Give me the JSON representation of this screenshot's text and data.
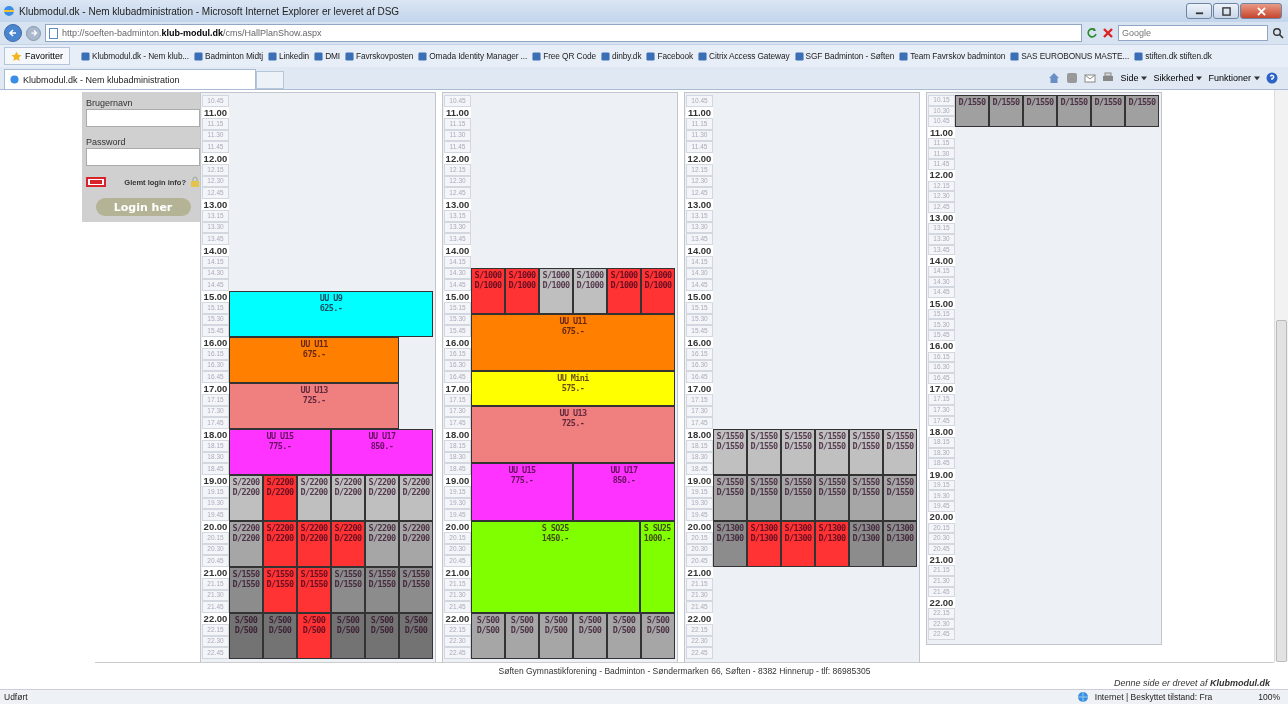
{
  "window": {
    "title": "Klubmodul.dk - Nem klubadministration - Microsoft Internet Explorer er leveret af DSG"
  },
  "address_bar": {
    "url": "http://soeften-badminton.**klub-modul.dk**/cms/HallPlanShow.aspx"
  },
  "search": {
    "placeholder": "Google"
  },
  "favorites": {
    "button": "Favoritter",
    "items": [
      "Klubmodul.dk - Nem klub...",
      "Badminton Midtj",
      "Linkedin",
      "DMI",
      "Favrskovposten",
      "Omada Identity Manager ...",
      "Free QR Code",
      "dinby.dk",
      "Facebook",
      "Citrix Access Gateway",
      "SGF Badminton - Søften",
      "Team Favrskov badminton",
      "SAS EUROBONUS MASTE...",
      "stiften.dk stiften.dk"
    ]
  },
  "tab": {
    "title": "Klubmodul.dk - Nem klubadministration"
  },
  "commands": [
    "Side",
    "Sikkerhed",
    "Funktioner"
  ],
  "login": {
    "username_label": "Brugernavn",
    "password_label": "Password",
    "forgot": "Glemt login info?",
    "button": "Login her"
  },
  "halls": [
    {
      "bands": [
        {
          "slots": [
            {
              "t": "10.45",
              "major": false
            },
            {
              "t": "11.00",
              "major": true
            },
            {
              "t": "11.15",
              "major": false
            },
            {
              "t": "11.30",
              "major": false
            },
            {
              "t": "11.45",
              "major": false
            },
            {
              "t": "12.00",
              "major": true
            },
            {
              "t": "12.15",
              "major": false
            },
            {
              "t": "12.30",
              "major": false
            },
            {
              "t": "12.45",
              "major": false
            },
            {
              "t": "13.00",
              "major": true
            },
            {
              "t": "13.15",
              "major": false
            },
            {
              "t": "13.30",
              "major": false
            },
            {
              "t": "13.45",
              "major": false
            },
            {
              "t": "14.00",
              "major": true
            },
            {
              "t": "14.15",
              "major": false
            },
            {
              "t": "14.30",
              "major": false
            },
            {
              "t": "14.45",
              "major": false
            }
          ]
        },
        {
          "slots": [
            {
              "t": "15.00",
              "major": true
            },
            {
              "t": "15.15",
              "major": false
            },
            {
              "t": "15.30",
              "major": false
            },
            {
              "t": "15.45",
              "major": false
            }
          ],
          "cells": [
            {
              "kind": "booking",
              "color": "#00ffff",
              "lines": [
                "UU U9",
                "625.-"
              ]
            },
            {
              "kind": "span"
            },
            {
              "kind": "span"
            },
            {
              "kind": "span"
            },
            {
              "kind": "span"
            },
            {
              "kind": "span"
            }
          ]
        },
        {
          "slots": [
            {
              "t": "16.00",
              "major": true
            },
            {
              "t": "16.15",
              "major": false
            },
            {
              "t": "16.30",
              "major": false
            },
            {
              "t": "16.45",
              "major": false
            }
          ],
          "cells": [
            {
              "kind": "booking",
              "color": "#ff8000",
              "lines": [
                "UU U11",
                "675.-"
              ]
            },
            {
              "kind": "span"
            },
            {
              "kind": "span"
            },
            {
              "kind": "span"
            },
            {
              "kind": "span"
            },
            {
              "kind": "free"
            }
          ]
        },
        {
          "slots": [
            {
              "t": "17.00",
              "major": true
            },
            {
              "t": "17.15",
              "major": false
            },
            {
              "t": "17.30",
              "major": false
            },
            {
              "t": "17.45",
              "major": false
            }
          ],
          "cells": [
            {
              "kind": "booking",
              "color": "#f08080",
              "lines": [
                "UU U13",
                "725.-"
              ]
            },
            {
              "kind": "span"
            },
            {
              "kind": "span"
            },
            {
              "kind": "span"
            },
            {
              "kind": "span"
            },
            {
              "kind": "free"
            }
          ]
        },
        {
          "slots": [
            {
              "t": "18.00",
              "major": true
            },
            {
              "t": "18.15",
              "major": false
            },
            {
              "t": "18.30",
              "major": false
            },
            {
              "t": "18.45",
              "major": false
            }
          ],
          "cells": [
            {
              "kind": "booking",
              "color": "#ff33ff",
              "lines": [
                "UU U15",
                "775.-"
              ]
            },
            {
              "kind": "span"
            },
            {
              "kind": "span"
            },
            {
              "kind": "booking",
              "color": "#ff33ff",
              "lines": [
                "UU U17",
                "850.-"
              ]
            },
            {
              "kind": "span"
            },
            {
              "kind": "span"
            }
          ]
        },
        {
          "slots": [
            {
              "t": "19.00",
              "major": true
            },
            {
              "t": "19.15",
              "major": false
            },
            {
              "t": "19.30",
              "major": false
            },
            {
              "t": "19.45",
              "major": false
            }
          ],
          "cells": [
            {
              "kind": "booking",
              "color": "#bfbfbf",
              "lines": [
                "S/2200",
                "D/2200"
              ]
            },
            {
              "kind": "booking",
              "color": "#ff3333",
              "lines": [
                "S/2200",
                "D/2200"
              ]
            },
            {
              "kind": "booking",
              "color": "#bfbfbf",
              "lines": [
                "S/2200",
                "D/2200"
              ]
            },
            {
              "kind": "booking",
              "color": "#bfbfbf",
              "lines": [
                "S/2200",
                "D/2200"
              ]
            },
            {
              "kind": "booking",
              "color": "#bfbfbf",
              "lines": [
                "S/2200",
                "D/2200"
              ]
            },
            {
              "kind": "booking",
              "color": "#bfbfbf",
              "lines": [
                "S/2200",
                "D/2200"
              ]
            }
          ]
        },
        {
          "slots": [
            {
              "t": "20.00",
              "major": true
            },
            {
              "t": "20.15",
              "major": false
            },
            {
              "t": "20.30",
              "major": false
            },
            {
              "t": "20.45",
              "major": false
            }
          ],
          "cells": [
            {
              "kind": "booking",
              "color": "#a6a6a6",
              "lines": [
                "S/2200",
                "D/2200"
              ]
            },
            {
              "kind": "booking",
              "color": "#ff3333",
              "lines": [
                "S/2200",
                "D/2200"
              ]
            },
            {
              "kind": "booking",
              "color": "#ff3333",
              "lines": [
                "S/2200",
                "D/2200"
              ]
            },
            {
              "kind": "booking",
              "color": "#ff3333",
              "lines": [
                "S/2200",
                "D/2200"
              ]
            },
            {
              "kind": "booking",
              "color": "#a6a6a6",
              "lines": [
                "S/2200",
                "D/2200"
              ]
            },
            {
              "kind": "booking",
              "color": "#a6a6a6",
              "lines": [
                "S/2200",
                "D/2200"
              ]
            }
          ]
        },
        {
          "slots": [
            {
              "t": "21.00",
              "major": true
            },
            {
              "t": "21.15",
              "major": false
            },
            {
              "t": "21.30",
              "major": false
            },
            {
              "t": "21.45",
              "major": false
            }
          ],
          "cells": [
            {
              "kind": "booking",
              "color": "#8c8c8c",
              "lines": [
                "S/1550",
                "D/1550"
              ]
            },
            {
              "kind": "booking",
              "color": "#ff3333",
              "lines": [
                "S/1550",
                "D/1550"
              ]
            },
            {
              "kind": "booking",
              "color": "#ff3333",
              "lines": [
                "S/1550",
                "D/1550"
              ]
            },
            {
              "kind": "booking",
              "color": "#8c8c8c",
              "lines": [
                "S/1550",
                "D/1550"
              ]
            },
            {
              "kind": "booking",
              "color": "#8c8c8c",
              "lines": [
                "S/1550",
                "D/1550"
              ]
            },
            {
              "kind": "booking",
              "color": "#8c8c8c",
              "lines": [
                "S/1550",
                "D/1550"
              ]
            }
          ]
        },
        {
          "slots": [
            {
              "t": "22.00",
              "major": true
            },
            {
              "t": "22.15",
              "major": false
            },
            {
              "t": "22.30",
              "major": false
            },
            {
              "t": "22.45",
              "major": false
            }
          ],
          "cells": [
            {
              "kind": "booking",
              "color": "#737373",
              "lines": [
                "S/500",
                "D/500"
              ]
            },
            {
              "kind": "booking",
              "color": "#737373",
              "lines": [
                "S/500",
                "D/500"
              ]
            },
            {
              "kind": "booking",
              "color": "#ff3333",
              "lines": [
                "S/500",
                "D/500"
              ]
            },
            {
              "kind": "booking",
              "color": "#737373",
              "lines": [
                "S/500",
                "D/500"
              ]
            },
            {
              "kind": "booking",
              "color": "#737373",
              "lines": [
                "S/500",
                "D/500"
              ]
            },
            {
              "kind": "booking",
              "color": "#737373",
              "lines": [
                "S/500",
                "D/500"
              ]
            }
          ]
        }
      ]
    },
    {
      "bands": [
        {
          "slots": [
            {
              "t": "10.45",
              "major": false
            },
            {
              "t": "11.00",
              "major": true
            },
            {
              "t": "11.15",
              "major": false
            },
            {
              "t": "11.30",
              "major": false
            },
            {
              "t": "11.45",
              "major": false
            },
            {
              "t": "12.00",
              "major": true
            },
            {
              "t": "12.15",
              "major": false
            },
            {
              "t": "12.30",
              "major": false
            },
            {
              "t": "12.45",
              "major": false
            },
            {
              "t": "13.00",
              "major": true
            },
            {
              "t": "13.15",
              "major": false
            },
            {
              "t": "13.30",
              "major": false
            },
            {
              "t": "13.45",
              "major": false
            },
            {
              "t": "14.00",
              "major": true
            },
            {
              "t": "14.15",
              "major": false
            }
          ]
        },
        {
          "slots": [
            {
              "t": "14.30",
              "major": false
            },
            {
              "t": "14.45",
              "major": false
            },
            {
              "t": "15.00",
              "major": true
            },
            {
              "t": "15.15",
              "major": false
            }
          ],
          "cells": [
            {
              "kind": "booking",
              "color": "#ff3333",
              "lines": [
                "S/1000",
                "D/1000"
              ]
            },
            {
              "kind": "booking",
              "color": "#ff3333",
              "lines": [
                "S/1000",
                "D/1000"
              ]
            },
            {
              "kind": "booking",
              "color": "#bfbfbf",
              "lines": [
                "S/1000",
                "D/1000"
              ]
            },
            {
              "kind": "booking",
              "color": "#bfbfbf",
              "lines": [
                "S/1000",
                "D/1000"
              ]
            },
            {
              "kind": "booking",
              "color": "#ff3333",
              "lines": [
                "S/1000",
                "D/1000"
              ]
            },
            {
              "kind": "booking",
              "color": "#ff3333",
              "lines": [
                "S/1000",
                "D/1000"
              ]
            }
          ]
        },
        {
          "slots": [
            {
              "t": "15.30",
              "major": false
            },
            {
              "t": "15.45",
              "major": false
            },
            {
              "t": "16.00",
              "major": true
            },
            {
              "t": "16.15",
              "major": false
            },
            {
              "t": "16.30",
              "major": false
            }
          ],
          "cells": [
            {
              "kind": "booking",
              "color": "#ff8000",
              "lines": [
                "UU U11",
                "675.-"
              ]
            },
            {
              "kind": "span"
            },
            {
              "kind": "span"
            },
            {
              "kind": "span"
            },
            {
              "kind": "span"
            },
            {
              "kind": "span"
            }
          ]
        },
        {
          "slots": [
            {
              "t": "16.45",
              "major": false
            },
            {
              "t": "17.00",
              "major": true
            },
            {
              "t": "17.15",
              "major": false
            }
          ],
          "cells": [
            {
              "kind": "booking",
              "color": "#ffff00",
              "lines": [
                "UU Mini",
                "575.-"
              ]
            },
            {
              "kind": "span"
            },
            {
              "kind": "span"
            },
            {
              "kind": "span"
            },
            {
              "kind": "span"
            },
            {
              "kind": "span"
            }
          ]
        },
        {
          "slots": [
            {
              "t": "17.30",
              "major": false
            },
            {
              "t": "17.45",
              "major": false
            },
            {
              "t": "18.00",
              "major": true
            },
            {
              "t": "18.15",
              "major": false
            },
            {
              "t": "18.30",
              "major": false
            }
          ],
          "cells": [
            {
              "kind": "booking",
              "color": "#f08080",
              "lines": [
                "UU U13",
                "725.-"
              ]
            },
            {
              "kind": "span"
            },
            {
              "kind": "span"
            },
            {
              "kind": "span"
            },
            {
              "kind": "span"
            },
            {
              "kind": "span"
            }
          ]
        },
        {
          "slots": [
            {
              "t": "18.45",
              "major": false
            },
            {
              "t": "19.00",
              "major": true
            },
            {
              "t": "19.15",
              "major": false
            },
            {
              "t": "19.30",
              "major": false
            },
            {
              "t": "19.45",
              "major": false
            }
          ],
          "cells": [
            {
              "kind": "booking",
              "color": "#ff33ff",
              "lines": [
                "UU U15",
                "775.-"
              ]
            },
            {
              "kind": "span"
            },
            {
              "kind": "span"
            },
            {
              "kind": "booking",
              "color": "#ff33ff",
              "lines": [
                "UU U17",
                "850.-"
              ]
            },
            {
              "kind": "span"
            },
            {
              "kind": "span"
            }
          ]
        },
        {
          "slots": [
            {
              "t": "20.00",
              "major": true
            },
            {
              "t": "20.15",
              "major": false
            },
            {
              "t": "20.30",
              "major": false
            },
            {
              "t": "20.45",
              "major": false
            },
            {
              "t": "21.00",
              "major": true
            },
            {
              "t": "21.15",
              "major": false
            },
            {
              "t": "21.30",
              "major": false
            },
            {
              "t": "21.45",
              "major": false
            }
          ],
          "cells": [
            {
              "kind": "booking",
              "color": "#80ff00",
              "lines": [
                "S SO25",
                "1450.-"
              ]
            },
            {
              "kind": "span"
            },
            {
              "kind": "span"
            },
            {
              "kind": "span"
            },
            {
              "kind": "span"
            },
            {
              "kind": "booking",
              "color": "#80ff00",
              "lines": [
                "S SU25",
                "1000.-"
              ]
            }
          ]
        },
        {
          "slots": [
            {
              "t": "22.00",
              "major": true
            },
            {
              "t": "22.15",
              "major": false
            },
            {
              "t": "22.30",
              "major": false
            },
            {
              "t": "22.45",
              "major": false
            }
          ],
          "cells": [
            {
              "kind": "booking",
              "color": "#a6a6a6",
              "lines": [
                "S/500",
                "D/500"
              ]
            },
            {
              "kind": "booking",
              "color": "#a6a6a6",
              "lines": [
                "S/500",
                "D/500"
              ]
            },
            {
              "kind": "booking",
              "color": "#a6a6a6",
              "lines": [
                "S/500",
                "D/500"
              ]
            },
            {
              "kind": "booking",
              "color": "#a6a6a6",
              "lines": [
                "S/500",
                "D/500"
              ]
            },
            {
              "kind": "booking",
              "color": "#a6a6a6",
              "lines": [
                "S/500",
                "D/500"
              ]
            },
            {
              "kind": "booking",
              "color": "#a6a6a6",
              "lines": [
                "S/500",
                "D/500"
              ]
            }
          ]
        }
      ]
    },
    {
      "bands": [
        {
          "slots": [
            {
              "t": "10.45",
              "major": false
            },
            {
              "t": "11.00",
              "major": true
            },
            {
              "t": "11.15",
              "major": false
            },
            {
              "t": "11.30",
              "major": false
            },
            {
              "t": "11.45",
              "major": false
            },
            {
              "t": "12.00",
              "major": true
            },
            {
              "t": "12.15",
              "major": false
            },
            {
              "t": "12.30",
              "major": false
            },
            {
              "t": "12.45",
              "major": false
            },
            {
              "t": "13.00",
              "major": true
            },
            {
              "t": "13.15",
              "major": false
            },
            {
              "t": "13.30",
              "major": false
            },
            {
              "t": "13.45",
              "major": false
            },
            {
              "t": "14.00",
              "major": true
            },
            {
              "t": "14.15",
              "major": false
            },
            {
              "t": "14.30",
              "major": false
            },
            {
              "t": "14.45",
              "major": false
            },
            {
              "t": "15.00",
              "major": true
            },
            {
              "t": "15.15",
              "major": false
            },
            {
              "t": "15.30",
              "major": false
            },
            {
              "t": "15.45",
              "major": false
            },
            {
              "t": "16.00",
              "major": true
            },
            {
              "t": "16.15",
              "major": false
            },
            {
              "t": "16.30",
              "major": false
            },
            {
              "t": "16.45",
              "major": false
            },
            {
              "t": "17.00",
              "major": true
            },
            {
              "t": "17.15",
              "major": false
            },
            {
              "t": "17.30",
              "major": false
            },
            {
              "t": "17.45",
              "major": false
            }
          ]
        },
        {
          "slots": [
            {
              "t": "18.00",
              "major": true
            },
            {
              "t": "18.15",
              "major": false
            },
            {
              "t": "18.30",
              "major": false
            },
            {
              "t": "18.45",
              "major": false
            }
          ],
          "cells": [
            {
              "kind": "booking",
              "color": "#c0c0c0",
              "lines": [
                "S/1550",
                "D/1550"
              ]
            },
            {
              "kind": "booking",
              "color": "#c0c0c0",
              "lines": [
                "S/1550",
                "D/1550"
              ]
            },
            {
              "kind": "booking",
              "color": "#c0c0c0",
              "lines": [
                "S/1550",
                "D/1550"
              ]
            },
            {
              "kind": "booking",
              "color": "#c0c0c0",
              "lines": [
                "S/1550",
                "D/1550"
              ]
            },
            {
              "kind": "booking",
              "color": "#c0c0c0",
              "lines": [
                "S/1550",
                "D/1550"
              ]
            },
            {
              "kind": "booking",
              "color": "#c0c0c0",
              "lines": [
                "S/1550",
                "D/1550"
              ]
            }
          ]
        },
        {
          "slots": [
            {
              "t": "19.00",
              "major": true
            },
            {
              "t": "19.15",
              "major": false
            },
            {
              "t": "19.30",
              "major": false
            },
            {
              "t": "19.45",
              "major": false
            }
          ],
          "cells": [
            {
              "kind": "booking",
              "color": "#a6a6a6",
              "lines": [
                "S/1550",
                "D/1550"
              ]
            },
            {
              "kind": "booking",
              "color": "#a6a6a6",
              "lines": [
                "S/1550",
                "D/1550"
              ]
            },
            {
              "kind": "booking",
              "color": "#a6a6a6",
              "lines": [
                "S/1550",
                "D/1550"
              ]
            },
            {
              "kind": "booking",
              "color": "#a6a6a6",
              "lines": [
                "S/1550",
                "D/1550"
              ]
            },
            {
              "kind": "booking",
              "color": "#a6a6a6",
              "lines": [
                "S/1550",
                "D/1550"
              ]
            },
            {
              "kind": "booking",
              "color": "#a6a6a6",
              "lines": [
                "S/1550",
                "D/1550"
              ]
            }
          ]
        },
        {
          "slots": [
            {
              "t": "20.00",
              "major": true
            },
            {
              "t": "20.15",
              "major": false
            },
            {
              "t": "20.30",
              "major": false
            },
            {
              "t": "20.45",
              "major": false
            }
          ],
          "cells": [
            {
              "kind": "booking",
              "color": "#8c8c8c",
              "lines": [
                "S/1300",
                "D/1300"
              ]
            },
            {
              "kind": "booking",
              "color": "#ff3333",
              "lines": [
                "S/1300",
                "D/1300"
              ]
            },
            {
              "kind": "booking",
              "color": "#ff3333",
              "lines": [
                "S/1300",
                "D/1300"
              ]
            },
            {
              "kind": "booking",
              "color": "#ff3333",
              "lines": [
                "S/1300",
                "D/1300"
              ]
            },
            {
              "kind": "booking",
              "color": "#8c8c8c",
              "lines": [
                "S/1300",
                "D/1300"
              ]
            },
            {
              "kind": "booking",
              "color": "#8c8c8c",
              "lines": [
                "S/1300",
                "D/1300"
              ]
            }
          ]
        },
        {
          "slots": [
            {
              "t": "21.00",
              "major": true
            },
            {
              "t": "21.15",
              "major": false
            },
            {
              "t": "21.30",
              "major": false
            },
            {
              "t": "21.45",
              "major": false
            },
            {
              "t": "22.00",
              "major": true
            },
            {
              "t": "22.15",
              "major": false
            },
            {
              "t": "22.30",
              "major": false
            },
            {
              "t": "22.45",
              "major": false
            }
          ]
        }
      ]
    },
    {
      "bands": [
        {
          "slots": [
            {
              "t": "10.15",
              "major": false
            },
            {
              "t": "10.30",
              "major": false
            },
            {
              "t": "10.45",
              "major": false
            }
          ],
          "cells": [
            {
              "kind": "booking",
              "color": "#a0a0a0",
              "lines": [
                "D/1550"
              ]
            },
            {
              "kind": "booking",
              "color": "#a0a0a0",
              "lines": [
                "D/1550"
              ]
            },
            {
              "kind": "booking",
              "color": "#a0a0a0",
              "lines": [
                "D/1550"
              ]
            },
            {
              "kind": "booking",
              "color": "#a0a0a0",
              "lines": [
                "D/1550"
              ]
            },
            {
              "kind": "booking",
              "color": "#a0a0a0",
              "lines": [
                "D/1550"
              ]
            },
            {
              "kind": "booking",
              "color": "#a0a0a0",
              "lines": [
                "D/1550"
              ]
            }
          ]
        },
        {
          "slots": [
            {
              "t": "11.00",
              "major": true
            },
            {
              "t": "11.15",
              "major": false
            },
            {
              "t": "11.30",
              "major": false
            },
            {
              "t": "11.45",
              "major": false
            },
            {
              "t": "12.00",
              "major": true
            },
            {
              "t": "12.15",
              "major": false
            },
            {
              "t": "12.30",
              "major": false
            },
            {
              "t": "12.45",
              "major": false
            },
            {
              "t": "13.00",
              "major": true
            },
            {
              "t": "13.15",
              "major": false
            },
            {
              "t": "13.30",
              "major": false
            },
            {
              "t": "13.45",
              "major": false
            },
            {
              "t": "14.00",
              "major": true
            },
            {
              "t": "14.15",
              "major": false
            },
            {
              "t": "14.30",
              "major": false
            },
            {
              "t": "14.45",
              "major": false
            },
            {
              "t": "15.00",
              "major": true
            },
            {
              "t": "15.15",
              "major": false
            },
            {
              "t": "15.30",
              "major": false
            },
            {
              "t": "15.45",
              "major": false
            },
            {
              "t": "16.00",
              "major": true
            },
            {
              "t": "16.15",
              "major": false
            },
            {
              "t": "16.30",
              "major": false
            },
            {
              "t": "16.45",
              "major": false
            },
            {
              "t": "17.00",
              "major": true
            },
            {
              "t": "17.15",
              "major": false
            },
            {
              "t": "17.30",
              "major": false
            },
            {
              "t": "17.45",
              "major": false
            },
            {
              "t": "18.00",
              "major": true
            },
            {
              "t": "18.15",
              "major": false
            },
            {
              "t": "18.30",
              "major": false
            },
            {
              "t": "18.45",
              "major": false
            },
            {
              "t": "19.00",
              "major": true
            },
            {
              "t": "19.15",
              "major": false
            },
            {
              "t": "19.30",
              "major": false
            },
            {
              "t": "19.45",
              "major": false
            },
            {
              "t": "20.00",
              "major": true
            },
            {
              "t": "20.15",
              "major": false
            },
            {
              "t": "20.30",
              "major": false
            },
            {
              "t": "20.45",
              "major": false
            },
            {
              "t": "21.00",
              "major": true
            },
            {
              "t": "21.15",
              "major": false
            },
            {
              "t": "21.30",
              "major": false
            },
            {
              "t": "21.45",
              "major": false
            },
            {
              "t": "22.00",
              "major": true
            },
            {
              "t": "22.15",
              "major": false
            },
            {
              "t": "22.30",
              "major": false
            },
            {
              "t": "22.45",
              "major": false
            }
          ]
        }
      ]
    }
  ],
  "footer": {
    "address": "Søften Gymnastikforening - Badminton - Søndermarken 66, Søften - 8382 Hinnerup - tlf: 86985305",
    "credit": "Denne side er drevet af **Klubmodul.dk**"
  },
  "status_bar": {
    "status": "Udført",
    "zone": "Internet | Beskyttet tilstand: Fra",
    "zoom": "100%"
  }
}
